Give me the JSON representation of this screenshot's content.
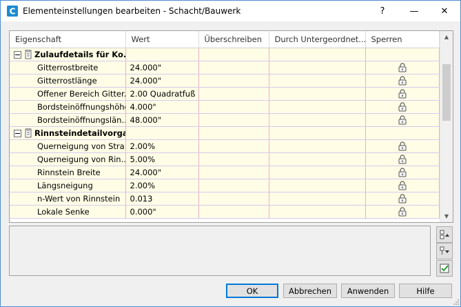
{
  "window": {
    "title": "Elementeinstellungen bearbeiten - Schacht/Bauwerk",
    "help_glyph": "?",
    "minimize_glyph": "—",
    "maximize_glyph": "☐",
    "close_glyph": "✕"
  },
  "grid": {
    "columns": [
      "Eigenschaft",
      "Wert",
      "Überschreiben",
      "Durch Untergeordnet...",
      "Sperren"
    ],
    "rows": [
      {
        "type": "category",
        "name": "Zulaufdetails für Ko...",
        "value": "",
        "locked": false
      },
      {
        "type": "property",
        "name": "Gitterrostbreite",
        "value": "24.000\"",
        "locked": true
      },
      {
        "type": "property",
        "name": "Gitterrostlänge",
        "value": "24.000\"",
        "locked": true
      },
      {
        "type": "property",
        "name": "Offener Bereich Gitter...",
        "value": "2.00 Quadratfuß",
        "locked": true
      },
      {
        "type": "property",
        "name": "Bordsteinöffnungshöhe",
        "value": "4.000\"",
        "locked": true
      },
      {
        "type": "property",
        "name": "Bordsteinöffnungslän...",
        "value": "48.000\"",
        "locked": true
      },
      {
        "type": "category",
        "name": "Rinnsteindetailvorga...",
        "value": "",
        "locked": false
      },
      {
        "type": "property",
        "name": "Querneigung von Stra...",
        "value": "2.00%",
        "locked": true
      },
      {
        "type": "property",
        "name": "Querneigung von Rin...",
        "value": "5.00%",
        "locked": true
      },
      {
        "type": "property",
        "name": "Rinnstein Breite",
        "value": "24.000\"",
        "locked": true
      },
      {
        "type": "property",
        "name": "Längsneigung",
        "value": "2.00%",
        "locked": true
      },
      {
        "type": "property",
        "name": "n-Wert von Rinnstein",
        "value": "0.013",
        "locked": true
      },
      {
        "type": "property",
        "name": "Lokale Senke",
        "value": "0.000\"",
        "locked": true
      }
    ]
  },
  "icons": {
    "app": "civil3d-logo-icon",
    "category": "category-properties-icon",
    "lock": "padlock-icon",
    "side_buttons": [
      "expand-all-categories-icon",
      "collapse-all-categories-icon",
      "apply-checkmark-icon"
    ]
  },
  "buttons": {
    "ok": "OK",
    "cancel": "Abbrechen",
    "apply": "Anwenden",
    "help": "Hilfe"
  },
  "colors": {
    "row_background": "#fffde6",
    "grid_line_horizontal": "#d7c8ef",
    "grid_line_vertical": "#e8b0c4",
    "accent": "#0078d7",
    "app_icon": "#1e8bd1"
  }
}
